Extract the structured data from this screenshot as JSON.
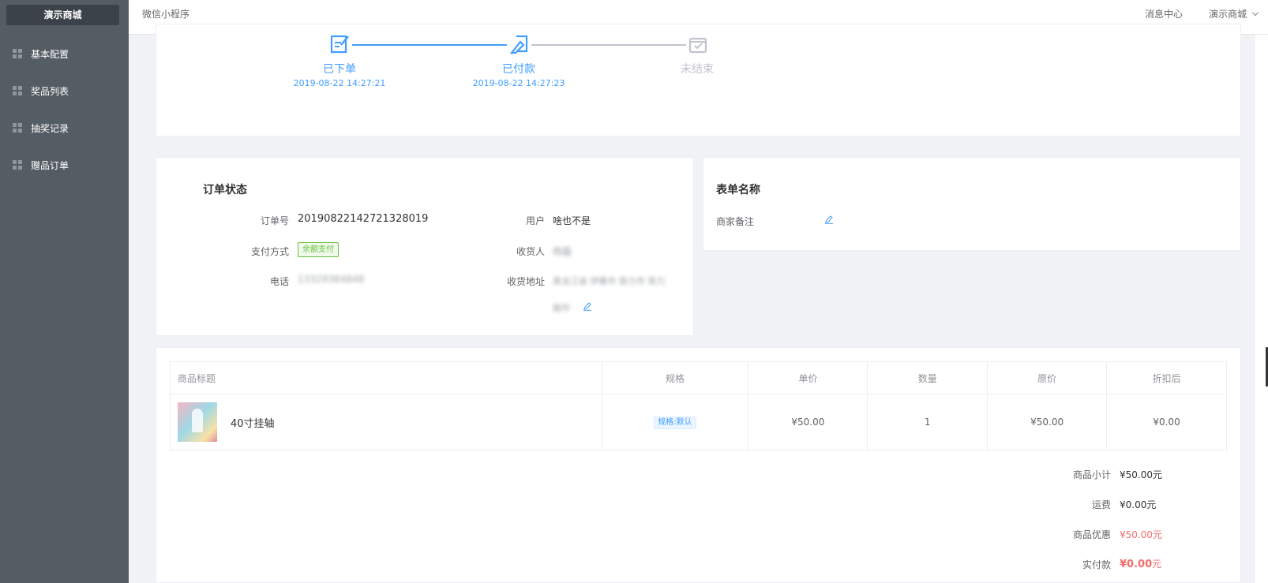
{
  "sidebar": {
    "brand": "演示商城",
    "items": [
      {
        "label": "基本配置"
      },
      {
        "label": "奖品列表"
      },
      {
        "label": "抽奖记录"
      },
      {
        "label": "赠品订单"
      }
    ]
  },
  "topbar": {
    "title": "微信小程序",
    "message_center": "消息中心",
    "user": "演示商城"
  },
  "steps": [
    {
      "label": "已下单",
      "time": "2019-08-22 14:27:21",
      "state": "done"
    },
    {
      "label": "已付款",
      "time": "2019-08-22 14:27:23",
      "state": "done"
    },
    {
      "label": "未结束",
      "time": "",
      "state": "pending"
    }
  ],
  "order": {
    "title": "订单状态",
    "order_no_label": "订单号",
    "order_no": "20190822142721328019",
    "pay_label": "支付方式",
    "pay_method": "余额支付",
    "phone_label": "电话",
    "phone": "13329384848",
    "user_label": "用户",
    "user": "啥也不是",
    "receiver_label": "收货人",
    "receiver": "杨磊",
    "address_label": "收货地址",
    "address_line1": "黑龙江省 伊春市 铁力市 铁力",
    "address_line2": "路作"
  },
  "form": {
    "title": "表单名称",
    "remark_label": "商家备注"
  },
  "goods_table": {
    "headers": [
      "商品标题",
      "规格",
      "单价",
      "数量",
      "原价",
      "折扣后"
    ],
    "rows": [
      {
        "title": "40寸挂轴",
        "spec": "规格:默认",
        "unit_price": "¥50.00",
        "quantity": "1",
        "original_price": "¥50.00",
        "discounted": "¥0.00"
      }
    ]
  },
  "summary": {
    "subtotal_label": "商品小计",
    "subtotal": "¥50.00元",
    "shipping_label": "运费",
    "shipping": "¥0.00元",
    "discount_label": "商品优惠",
    "discount": "¥50.00元",
    "paid_label": "实付款",
    "paid_amount": "¥0.00",
    "paid_unit": "元"
  },
  "colors": {
    "sidebar_bg": "#545c64",
    "accent": "#409eff",
    "danger": "#f56c6c",
    "success": "#67c23a",
    "muted": "#c0c4cc"
  }
}
